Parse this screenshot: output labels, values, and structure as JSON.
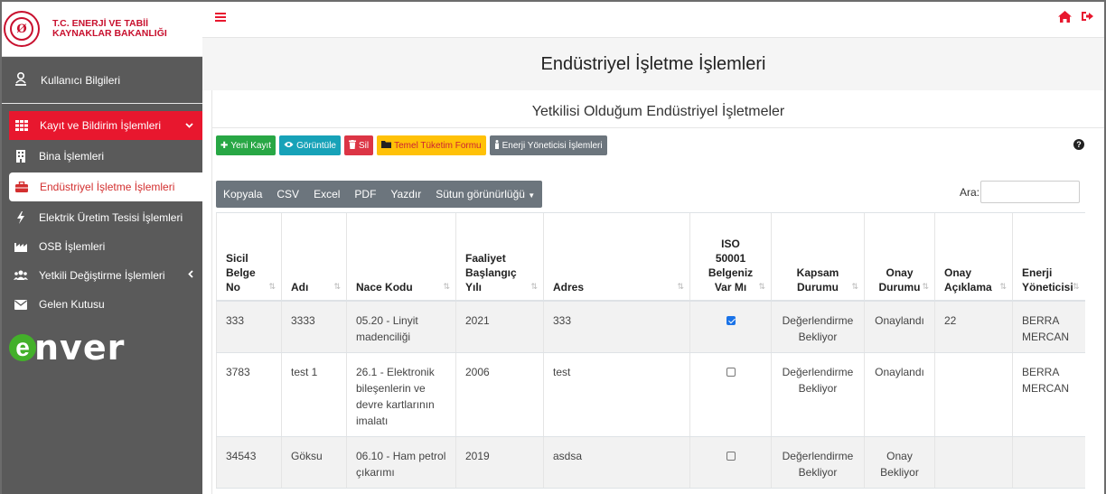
{
  "brand": {
    "line1": "T.C. ENERJİ VE TABİİ",
    "line2": "KAYNAKLAR BAKANLIĞI"
  },
  "sidebar": {
    "user_label": "Kullanıcı Bilgileri",
    "items": [
      {
        "label": "Kayıt ve Bildirim İşlemleri"
      },
      {
        "label": "Bina İşlemleri"
      },
      {
        "label": "Endüstriyel İşletme İşlemleri"
      },
      {
        "label": "Elektrik Üretim Tesisi İşlemleri"
      },
      {
        "label": "OSB İşlemleri"
      },
      {
        "label": "Yetkili Değiştirme İşlemleri"
      },
      {
        "label": "Gelen Kutusu"
      }
    ],
    "logo_text": "nver"
  },
  "page": {
    "title": "Endüstriyel İşletme İşlemleri",
    "card_title": "Yetkilisi Olduğum Endüstriyel İşletmeler"
  },
  "toolbar": {
    "new": "Yeni Kayıt",
    "view": "Görüntüle",
    "delete": "Sil",
    "consumption": "Temel Tüketim Formu",
    "manager": "Enerji Yöneticisi İşlemleri"
  },
  "dt": {
    "copy": "Kopyala",
    "csv": "CSV",
    "excel": "Excel",
    "pdf": "PDF",
    "print": "Yazdır",
    "columns": "Sütun görünürlüğü",
    "search_label": "Ara:",
    "search_value": ""
  },
  "table": {
    "headers": [
      [
        "Sicil",
        "Belge",
        "No"
      ],
      [
        "Adı"
      ],
      [
        "Nace Kodu"
      ],
      [
        "Faaliyet",
        "Başlangıç",
        "Yılı"
      ],
      [
        "Adres"
      ],
      [
        "ISO",
        "50001",
        "Belgeniz",
        "Var Mı"
      ],
      [
        "Kapsam",
        "Durumu"
      ],
      [
        "Onay",
        "Durumu"
      ],
      [
        "Onay",
        "Açıklama"
      ],
      [
        "Enerji",
        "Yöneticisi"
      ]
    ],
    "rows": [
      {
        "sicil": "333",
        "adi": "3333",
        "nace": [
          "05.20 - Linyit",
          "madenciliği"
        ],
        "yil": "2021",
        "adres": "333",
        "iso": true,
        "kapsam": [
          "Değerlendirme",
          "Bekliyor"
        ],
        "onay": [
          "Onaylandı"
        ],
        "aciklama": "22",
        "yonetici": [
          "BERRA",
          "MERCAN"
        ]
      },
      {
        "sicil": "3783",
        "adi": "test 1",
        "nace": [
          "26.1 - Elektronik",
          "bileşenlerin ve",
          "devre kartlarının",
          "imalatı"
        ],
        "yil": "2006",
        "adres": "test",
        "iso": false,
        "kapsam": [
          "Değerlendirme",
          "Bekliyor"
        ],
        "onay": [
          "Onaylandı"
        ],
        "aciklama": "",
        "yonetici": [
          "BERRA",
          "MERCAN"
        ]
      },
      {
        "sicil": "34543",
        "adi": "Göksu",
        "nace": [
          "06.10 - Ham petrol",
          "çıkarımı"
        ],
        "yil": "2019",
        "adres": "asdsa",
        "iso": false,
        "kapsam": [
          "Değerlendirme",
          "Bekliyor"
        ],
        "onay": [
          "Onay",
          "Bekliyor"
        ],
        "aciklama": "",
        "yonetici": []
      }
    ]
  }
}
